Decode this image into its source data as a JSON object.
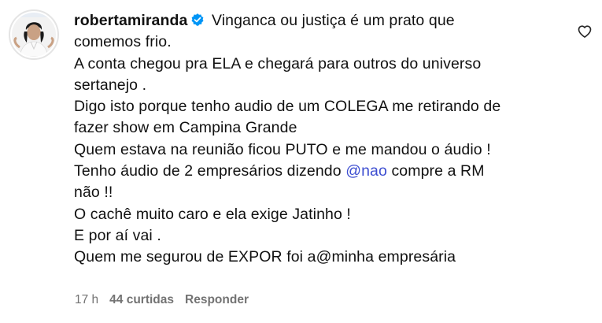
{
  "comment": {
    "username": "robertamiranda",
    "verified": true,
    "lines": [
      "Vinganca ou justiça é um prato que",
      "comemos frio.",
      "A conta chegou pra ELA e chegará para outros do universo",
      "sertanejo .",
      "Digo isto porque tenho audio de um COLEGA me retirando de",
      "fazer show em Campina Grande",
      "Quem estava na reunião ficou PUTO e me mandou o áudio !",
      "Tenho áudio de 2 empresários dizendo ",
      "não !!",
      "O cachê muito caro e ela exige Jatinho !",
      "E por aí vai .",
      "Quem me segurou de EXPOR foi a@minha empresária"
    ],
    "mention": "@nao",
    "line8_suffix": " compre a RM",
    "time": "17 h",
    "likes": "44 curtidas",
    "reply_label": "Responder",
    "like_icon": "heart-outline-icon",
    "colors": {
      "text": "#111111",
      "meta": "#737373",
      "mention": "#3d4ed1",
      "verified": "#0095f6"
    }
  }
}
